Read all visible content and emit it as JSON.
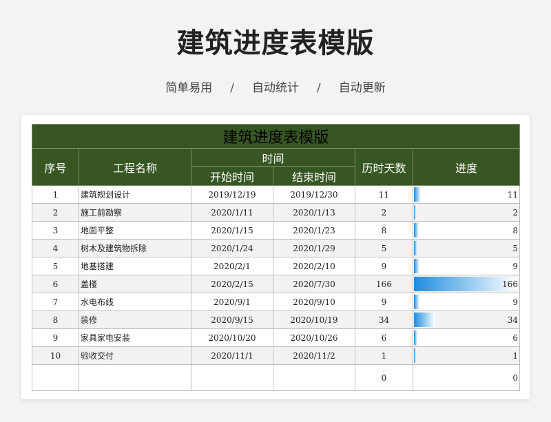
{
  "page": {
    "title": "建筑进度表模版",
    "subtitle": [
      "简单易用",
      "/",
      "自动统计",
      "/",
      "自动更新"
    ]
  },
  "sheet": {
    "title": "建筑进度表模版",
    "headers": {
      "seq": "序号",
      "name": "工程名称",
      "time": "时间",
      "start": "开始时间",
      "end": "结束时间",
      "days": "历时天数",
      "progress": "进度"
    },
    "max_days": 166,
    "rows": [
      {
        "seq": "1",
        "name": "建筑规划设计",
        "start": "2019/12/19",
        "end": "2019/12/30",
        "days": "11",
        "progress": 11
      },
      {
        "seq": "2",
        "name": "施工前勘察",
        "start": "2020/1/11",
        "end": "2020/1/13",
        "days": "2",
        "progress": 2
      },
      {
        "seq": "3",
        "name": "地面平整",
        "start": "2020/1/15",
        "end": "2020/1/23",
        "days": "8",
        "progress": 8
      },
      {
        "seq": "4",
        "name": "树木及建筑物拆除",
        "start": "2020/1/24",
        "end": "2020/1/29",
        "days": "5",
        "progress": 5
      },
      {
        "seq": "5",
        "name": "地基搭建",
        "start": "2020/2/1",
        "end": "2020/2/10",
        "days": "9",
        "progress": 9
      },
      {
        "seq": "6",
        "name": "盖楼",
        "start": "2020/2/15",
        "end": "2020/7/30",
        "days": "166",
        "progress": 166
      },
      {
        "seq": "7",
        "name": "水电布线",
        "start": "2020/9/1",
        "end": "2020/9/10",
        "days": "9",
        "progress": 9
      },
      {
        "seq": "8",
        "name": "装修",
        "start": "2020/9/15",
        "end": "2020/10/19",
        "days": "34",
        "progress": 34
      },
      {
        "seq": "9",
        "name": "家具家电安装",
        "start": "2020/10/20",
        "end": "2020/10/26",
        "days": "6",
        "progress": 6
      },
      {
        "seq": "10",
        "name": "验收交付",
        "start": "2020/11/1",
        "end": "2020/11/2",
        "days": "1",
        "progress": 1
      },
      {
        "seq": "",
        "name": "",
        "start": "",
        "end": "",
        "days": "0",
        "progress": 0
      }
    ]
  }
}
